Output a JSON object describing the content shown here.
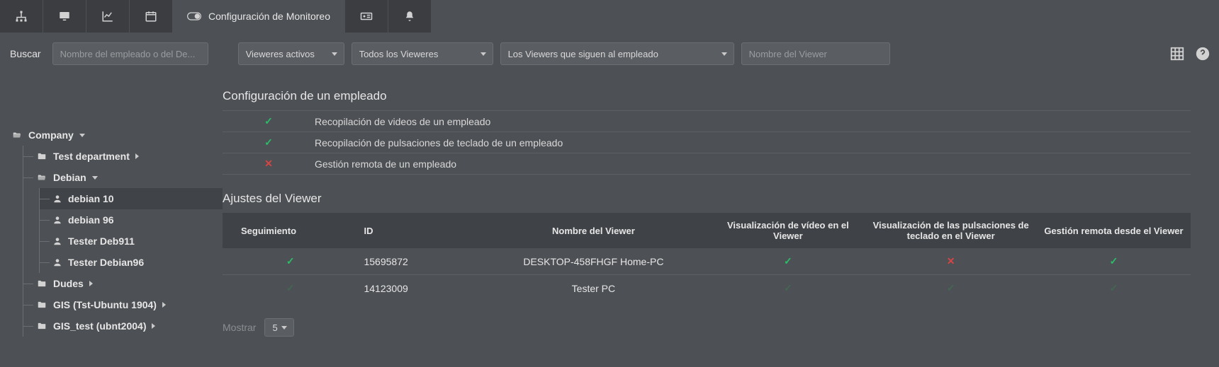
{
  "nav": {
    "active_label": "Configuración de Monitoreo"
  },
  "filters": {
    "search_label": "Buscar",
    "search_placeholder": "Nombre del empleado o del De...",
    "active_viewers": "Vieweres activos",
    "all_viewers": "Todos los Vieweres",
    "following": "Los Viewers que siguen al empleado",
    "viewer_name_placeholder": "Nombre del Viewer"
  },
  "tree": {
    "root": "Company",
    "items": [
      {
        "label": "Test department",
        "type": "folder",
        "expand": "right"
      },
      {
        "label": "Debian",
        "type": "folder-open",
        "expand": "down",
        "children": [
          {
            "label": "debian 10",
            "type": "user",
            "selected": true
          },
          {
            "label": "debian 96",
            "type": "user"
          },
          {
            "label": "Tester Deb911",
            "type": "user"
          },
          {
            "label": "Tester Debian96",
            "type": "user"
          }
        ]
      },
      {
        "label": "Dudes",
        "type": "folder",
        "expand": "right"
      },
      {
        "label": "GIS (Tst-Ubuntu 1904)",
        "type": "folder",
        "expand": "right"
      },
      {
        "label": "GIS_test (ubnt2004)",
        "type": "folder",
        "expand": "right"
      }
    ]
  },
  "employee_config": {
    "title": "Configuración de un empleado",
    "rows": [
      {
        "state": "on",
        "label": "Recopilación de videos de un empleado"
      },
      {
        "state": "on",
        "label": "Recopilación de pulsaciones de teclado de un empleado"
      },
      {
        "state": "off",
        "label": "Gestión remota de un empleado"
      }
    ]
  },
  "viewer_settings": {
    "title": "Ajustes del Viewer",
    "columns": {
      "follow": "Seguimiento",
      "id": "ID",
      "name": "Nombre del Viewer",
      "video": "Visualización de vídeo en el Viewer",
      "keys": "Visualización de las pulsaciones de teclado en el Viewer",
      "remote": "Gestión remota desde el Viewer"
    },
    "rows": [
      {
        "follow": "on",
        "id": "15695872",
        "name": "DESKTOP-458FHGF Home-PC",
        "video": "on",
        "keys": "off",
        "remote": "on"
      },
      {
        "follow": "muted",
        "id": "14123009",
        "name": "Tester PC",
        "video": "muted",
        "keys": "muted",
        "remote": "muted"
      }
    ]
  },
  "pager": {
    "label": "Mostrar",
    "value": "5"
  }
}
